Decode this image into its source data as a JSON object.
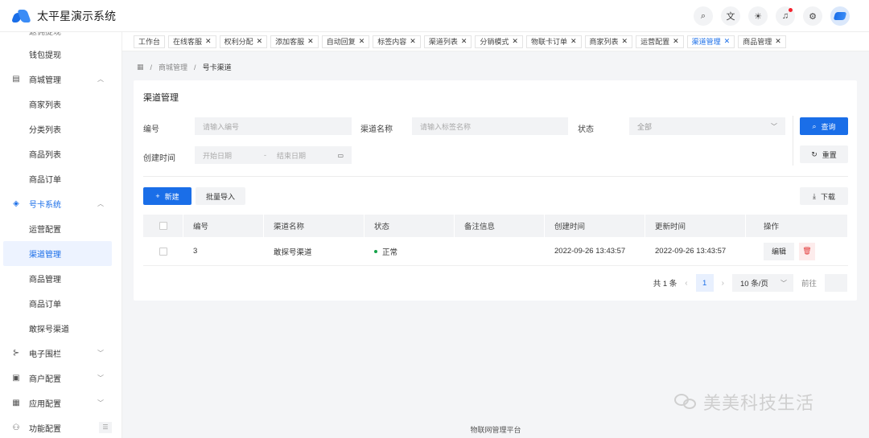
{
  "app": {
    "title": "太平星演示系统"
  },
  "header": {
    "icons": [
      "search-icon",
      "translate-icon",
      "theme-icon",
      "bell-icon",
      "settings-icon"
    ]
  },
  "sidebar": {
    "cut_item": "返佣提现",
    "items": [
      {
        "label": "钱包提现",
        "level": "sub"
      },
      {
        "label": "商城管理",
        "level": "top",
        "icon": "store-icon",
        "expanded": true
      },
      {
        "label": "商家列表",
        "level": "sub"
      },
      {
        "label": "分类列表",
        "level": "sub"
      },
      {
        "label": "商品列表",
        "level": "sub"
      },
      {
        "label": "商品订单",
        "level": "sub"
      },
      {
        "label": "号卡系统",
        "level": "top",
        "icon": "card-icon",
        "expanded": true,
        "current": true
      },
      {
        "label": "运营配置",
        "level": "sub"
      },
      {
        "label": "渠道管理",
        "level": "sub",
        "active": true
      },
      {
        "label": "商品管理",
        "level": "sub"
      },
      {
        "label": "商品订单",
        "level": "sub"
      },
      {
        "label": "敢探号渠道",
        "level": "sub"
      },
      {
        "label": "电子围栏",
        "level": "top",
        "icon": "fence-icon"
      },
      {
        "label": "商户配置",
        "level": "top",
        "icon": "merchant-icon"
      },
      {
        "label": "应用配置",
        "level": "top",
        "icon": "apps-icon"
      },
      {
        "label": "功能配置",
        "level": "top",
        "icon": "function-icon"
      }
    ]
  },
  "tabs": [
    {
      "label": "工作台",
      "closable": false
    },
    {
      "label": "在线客服",
      "closable": true
    },
    {
      "label": "权利分配",
      "closable": true
    },
    {
      "label": "添加客服",
      "closable": true
    },
    {
      "label": "自动回复",
      "closable": true
    },
    {
      "label": "标签内容",
      "closable": true
    },
    {
      "label": "渠道列表",
      "closable": true
    },
    {
      "label": "分销模式",
      "closable": true
    },
    {
      "label": "物联卡订单",
      "closable": true
    },
    {
      "label": "商家列表",
      "closable": true
    },
    {
      "label": "运营配置",
      "closable": true
    },
    {
      "label": "渠道管理",
      "closable": true,
      "active": true
    },
    {
      "label": "商品管理",
      "closable": true
    }
  ],
  "breadcrumb": {
    "home_icon": "grid-icon",
    "level1": "商城管理",
    "level2": "号卡渠道",
    "sep": "/"
  },
  "card": {
    "title": "渠道管理"
  },
  "filters": {
    "id_label": "编号",
    "id_placeholder": "请输入编号",
    "name_label": "渠道名称",
    "name_placeholder": "请输入标签名称",
    "status_label": "状态",
    "status_value": "全部",
    "created_label": "创建时间",
    "start_placeholder": "开始日期",
    "date_sep": "-",
    "end_placeholder": "结束日期",
    "query_button": "查询",
    "reset_button": "重置"
  },
  "toolbar": {
    "new_button": "新建",
    "import_button": "批量导入",
    "download_button": "下载"
  },
  "table": {
    "columns": [
      "编号",
      "渠道名称",
      "状态",
      "备注信息",
      "创建时间",
      "更新时间",
      "操作"
    ],
    "rows": [
      {
        "id": "3",
        "name": "敢探号渠道",
        "status": "正常",
        "remark": "",
        "created": "2022-09-26 13:43:57",
        "updated": "2022-09-26 13:43:57",
        "edit": "编辑"
      }
    ]
  },
  "pagination": {
    "total": "共 1 条",
    "current": "1",
    "page_size": "10 条/页",
    "goto": "前往"
  },
  "footer": {
    "text": "物联网管理平台"
  },
  "watermark": {
    "text": "美美科技生活"
  },
  "colors": {
    "primary": "#1a6ee8",
    "status_ok": "#16a34a",
    "danger": "#e23b3b"
  }
}
